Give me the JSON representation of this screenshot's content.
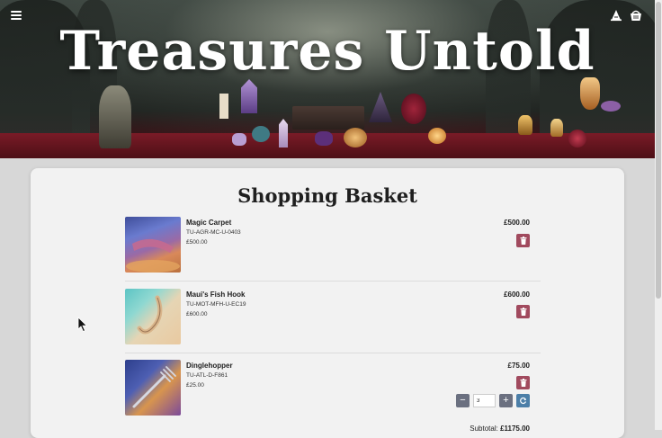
{
  "header": {
    "site_title": "Treasures Untold",
    "icons": [
      "menu-icon",
      "wizard-hat-icon",
      "basket-icon"
    ]
  },
  "basket": {
    "title": "Shopping Basket",
    "items": [
      {
        "name": "Magic Carpet",
        "sku": "TU-AGR-MC-U-0403",
        "unit_price": "£500.00",
        "line_total": "£500.00"
      },
      {
        "name": "Maui's Fish Hook",
        "sku": "TU-MOT-MFH-U-EC19",
        "unit_price": "£600.00",
        "line_total": "£600.00"
      },
      {
        "name": "Dinglehopper",
        "sku": "TU-ATL-D-F861",
        "unit_price": "£25.00",
        "line_total": "£75.00",
        "quantity": "3"
      }
    ],
    "subtotal_label": "Subtotal:",
    "subtotal_value": "£1175.00"
  },
  "colors": {
    "delete": "#a14a5e",
    "stepper": "#6b7080",
    "refresh": "#4c7fa8"
  }
}
